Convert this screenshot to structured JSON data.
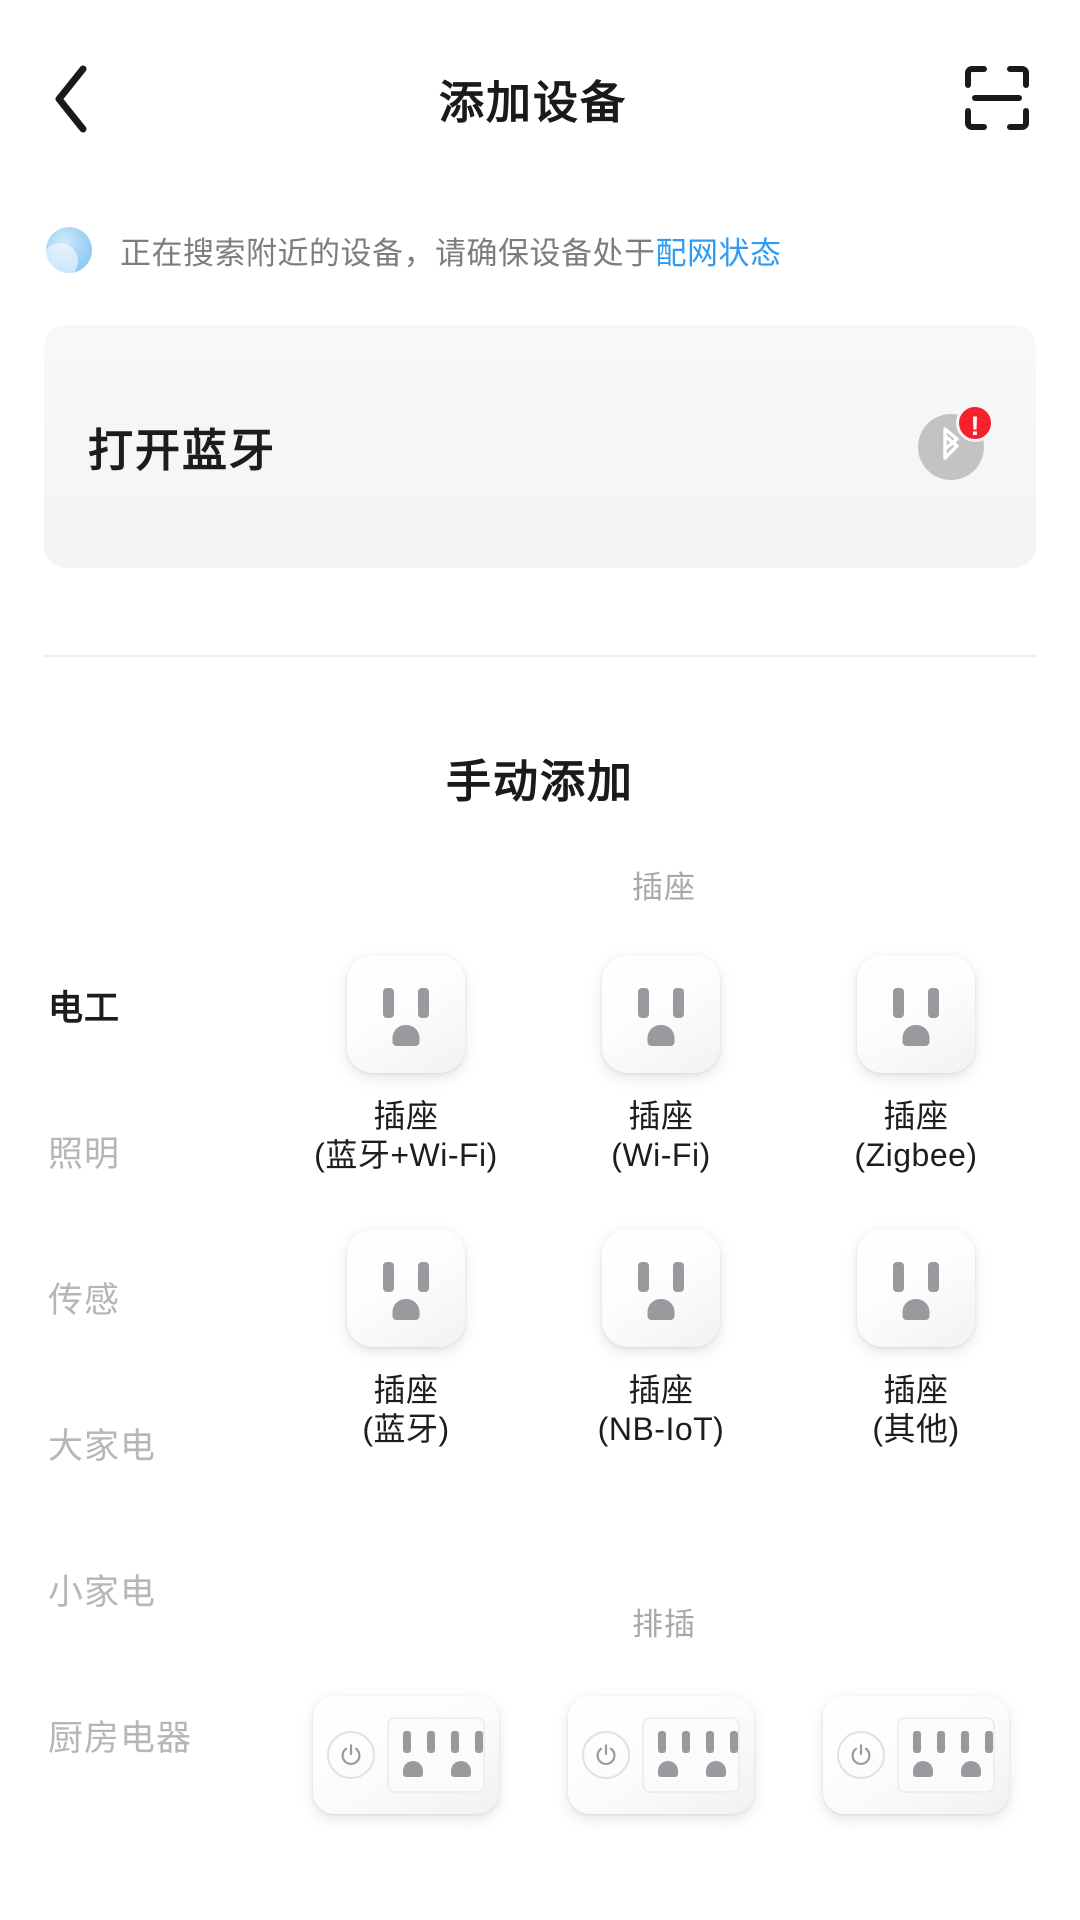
{
  "header": {
    "back_icon": "chevron-left-icon",
    "title": "添加设备",
    "scan_icon": "scan-qr-icon"
  },
  "search_status": {
    "icon": "radar-scanning-icon",
    "text": "正在搜索附近的设备，请确保设备处于",
    "link_text": "配网状态",
    "link_color": "#2f9bf5"
  },
  "bluetooth_card": {
    "label": "打开蓝牙",
    "icon": "bluetooth-icon",
    "badge": "!",
    "badge_color": "#f5222d"
  },
  "manual_section": {
    "title": "手动添加"
  },
  "sidebar": {
    "items": [
      {
        "label": "电工",
        "active": true
      },
      {
        "label": "照明",
        "active": false
      },
      {
        "label": "传感",
        "active": false
      },
      {
        "label": "大家电",
        "active": false
      },
      {
        "label": "小家电",
        "active": false
      },
      {
        "label": "厨房电器",
        "active": false
      }
    ]
  },
  "groups": [
    {
      "title": "插座",
      "rows": [
        [
          {
            "icon": "socket-icon",
            "name": "插座",
            "spec": "(蓝牙+Wi-Fi)"
          },
          {
            "icon": "socket-icon",
            "name": "插座",
            "spec": "(Wi-Fi)"
          },
          {
            "icon": "socket-icon",
            "name": "插座",
            "spec": "(Zigbee)"
          }
        ],
        [
          {
            "icon": "socket-icon",
            "name": "插座",
            "spec": "(蓝牙)"
          },
          {
            "icon": "socket-icon",
            "name": "插座",
            "spec": "(NB-IoT)"
          },
          {
            "icon": "socket-icon",
            "name": "插座",
            "spec": "(其他)"
          }
        ]
      ]
    },
    {
      "title": "排插",
      "rows": [
        [
          {
            "icon": "power-strip-icon",
            "name": "",
            "spec": ""
          },
          {
            "icon": "power-strip-icon",
            "name": "",
            "spec": ""
          },
          {
            "icon": "power-strip-icon",
            "name": "",
            "spec": ""
          }
        ]
      ]
    }
  ]
}
